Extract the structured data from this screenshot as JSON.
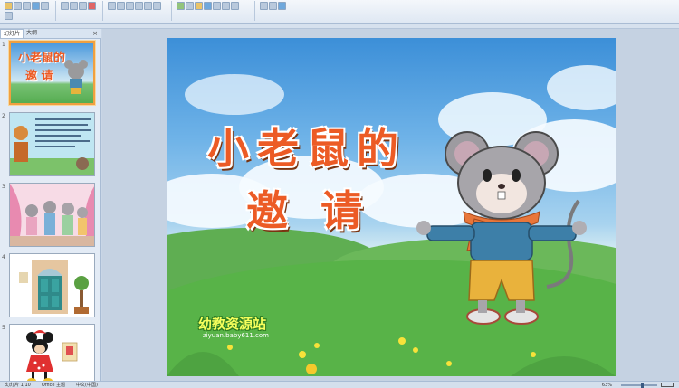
{
  "panel": {
    "tabs": [
      {
        "label": "幻灯片"
      },
      {
        "label": "大纲"
      }
    ],
    "close_glyph": "×",
    "slides": [
      {
        "number": "1",
        "title_line1": "小老鼠的",
        "title_line2": "邀 请"
      },
      {
        "number": "2"
      },
      {
        "number": "3"
      },
      {
        "number": "4"
      },
      {
        "number": "5"
      }
    ]
  },
  "slide": {
    "title_line1_chars": [
      "小",
      "老",
      "鼠",
      "的"
    ],
    "title_line2_chars": [
      "邀",
      "请"
    ],
    "logo_text": "幼教资源站",
    "logo_url": "ziyuan.baby611.com"
  },
  "status": {
    "slide_info": "幻灯片 1/10",
    "theme": "Office 主题",
    "language": "中文(中国)",
    "zoom": "63%"
  },
  "colors": {
    "title": "#ec5b25",
    "selected_border": "#f0a040",
    "sky": "#3c8fd8",
    "grass": "#4fa84a"
  }
}
